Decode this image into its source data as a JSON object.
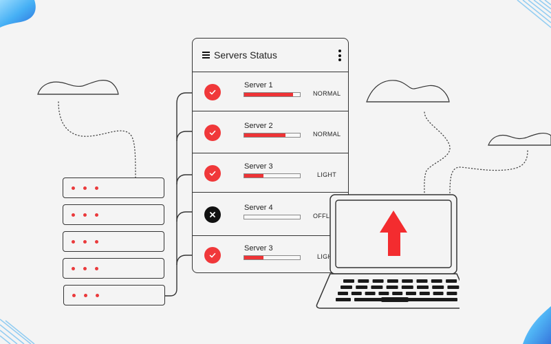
{
  "panel": {
    "title": "Servers Status",
    "menu_icon": "hamburger-icon",
    "more_icon": "kebab-menu-icon",
    "servers": [
      {
        "name": "Server 1",
        "status": "NORMAL",
        "load": 0.88,
        "state": "ok"
      },
      {
        "name": "Server 2",
        "status": "NORMAL",
        "load": 0.74,
        "state": "ok"
      },
      {
        "name": "Server 3",
        "status": "LIGHT",
        "load": 0.34,
        "state": "ok"
      },
      {
        "name": "Server 4",
        "status": "OFFL",
        "load": 0.0,
        "state": "off"
      },
      {
        "name": "Server 3",
        "status": "LIGH",
        "load": 0.35,
        "state": "ok"
      }
    ]
  },
  "rack": {
    "units": 5,
    "indicator_dots": 3
  },
  "laptop": {
    "screen_icon": "upload-arrow-icon"
  },
  "colors": {
    "accent": "#f0383a",
    "dark": "#111111",
    "background": "#f4f4f4",
    "decoration": "#4fb3f0"
  }
}
